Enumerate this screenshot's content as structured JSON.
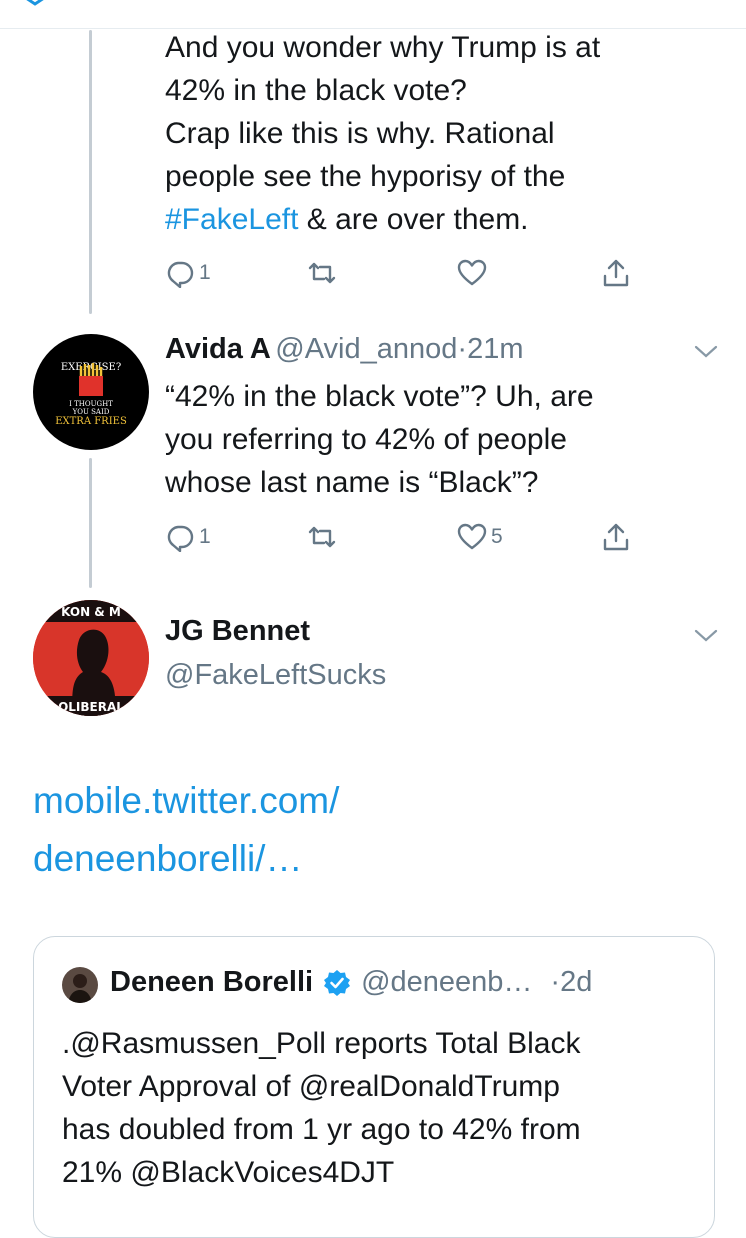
{
  "top_tweet": {
    "text_line1": "And you wonder why Trump is at",
    "text_line2": "42% in the black vote?",
    "text_line3": "Crap like this is why. Rational",
    "text_line4": "people see the hyporisy of the",
    "hashtag": "#FakeLeft",
    "text_line5_rest": " & are over them.",
    "reply_count": "1"
  },
  "reply_tweet": {
    "name": "Avida A",
    "handle": "@Avid_annod",
    "separator": "·",
    "time": "21m",
    "text_line1": "“42% in the black vote”? Uh, are",
    "text_line2": "you referring to 42% of people",
    "text_line3": "whose last name is “Black”?",
    "reply_count": "1",
    "like_count": "5",
    "avatar_text": {
      "line1": "EXERCISE?",
      "line2": "I THOUGHT",
      "line3": "YOU SAID",
      "line4": "EXTRA FRIES"
    }
  },
  "main_tweet": {
    "name": "JG Bennet",
    "handle": "@FakeLeftSucks",
    "link_line1": "mobile.twitter.com/",
    "link_line2": "deneenborelli/…",
    "avatar_text": {
      "top": "KON & M",
      "bottom": "OLIBERAL"
    }
  },
  "quoted_tweet": {
    "name": "Deneen Borelli",
    "handle": "@deneenb…",
    "separator": "·",
    "time": "2d",
    "line1": ".@Rasmussen_Poll reports Total Black",
    "line2": "Voter Approval of @realDonaldTrump",
    "line3": "has doubled from 1 yr ago to 42% from",
    "line4": "21% @BlackVoices4DJT"
  },
  "colors": {
    "link": "#1b95e0",
    "secondary": "#657786",
    "thread_line": "#c4ccd3",
    "verified": "#1da1f2"
  }
}
